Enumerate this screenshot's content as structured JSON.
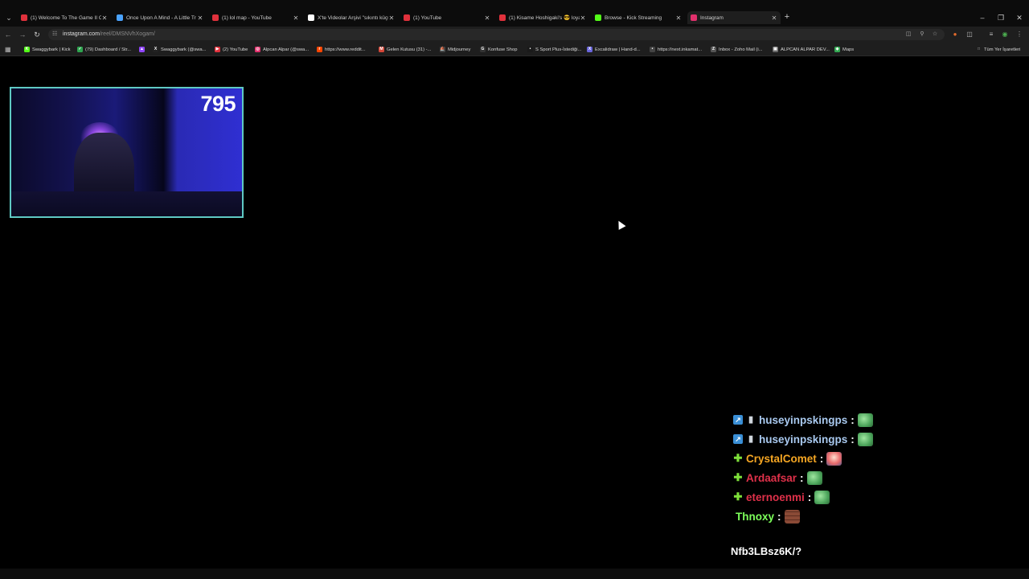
{
  "browser": {
    "tabs": [
      {
        "title": "(1) Welcome To The Game II Of",
        "favicon": "youtube-icon",
        "color": "#e0313c",
        "active": false
      },
      {
        "title": "Once Upon A Mind - A Little Tr",
        "favicon": "bird-icon",
        "color": "#4aa3ff",
        "active": false
      },
      {
        "title": "(1) lol map - YouTube",
        "favicon": "youtube-icon",
        "color": "#e0313c",
        "active": false
      },
      {
        "title": "X'te Videolar Arşivi \"sıkıntı küçü",
        "favicon": "x-icon",
        "color": "#ffffff",
        "active": false
      },
      {
        "title": "(1) YouTube",
        "favicon": "youtube-icon",
        "color": "#e0313c",
        "active": false
      },
      {
        "title": "(1) Kisame Hoshigaki's 😎 loya",
        "favicon": "youtube-icon",
        "color": "#e0313c",
        "active": false
      },
      {
        "title": "Browse - Kick Streaming",
        "favicon": "kick-icon",
        "color": "#53fc18",
        "active": false
      },
      {
        "title": "Instagram",
        "favicon": "instagram-icon",
        "color": "#e1306c",
        "active": true
      }
    ],
    "address": {
      "host": "instagram.com",
      "path": "/reel/DMSNVhXogam/"
    },
    "bookmarks": [
      {
        "label": "Swaggybark | Kick",
        "color": "#53fc18",
        "letter": "K"
      },
      {
        "label": "(79) Dashboard / Str...",
        "color": "#2ea44f",
        "letter": "✓"
      },
      {
        "label": "",
        "color": "#9146ff",
        "letter": "▲"
      },
      {
        "label": "Swaggybark (@swa...",
        "color": "#222222",
        "letter": "X"
      },
      {
        "label": "(2) YouTube",
        "color": "#e0313c",
        "letter": "▶"
      },
      {
        "label": "Alpcan Alpar (@swa...",
        "color": "#e1306c",
        "letter": "◎"
      },
      {
        "label": "https://www.reddit...",
        "color": "#ff4500",
        "letter": "r"
      },
      {
        "label": "Gelen Kutusu (31) -...",
        "color": "#d44638",
        "letter": "M"
      },
      {
        "label": "Midjourney",
        "color": "#444444",
        "letter": "⛵"
      },
      {
        "label": "Konfuse Shop",
        "color": "#333333",
        "letter": "G"
      },
      {
        "label": "S Sport Plus-İstediği...",
        "color": "#1a1a1a",
        "letter": "•"
      },
      {
        "label": "Excalidraw | Hand-d...",
        "color": "#6965db",
        "letter": "X"
      },
      {
        "label": "https://next.inkamat...",
        "color": "#444444",
        "letter": "•"
      },
      {
        "label": "Inbox - Zoho Mail (i...",
        "color": "#555555",
        "letter": "Z"
      },
      {
        "label": "ALPCAN ALPAR DEV...",
        "color": "#666666",
        "letter": "▣"
      },
      {
        "label": "Maps",
        "color": "#34a853",
        "letter": "◈"
      }
    ],
    "all_bookmarks_label": "Tüm Yer İşaretleri"
  },
  "stream": {
    "viewer_count": "795"
  },
  "chat": {
    "messages": [
      {
        "user": "huseyinpskingps",
        "color": "#a9c9ef",
        "badges": [
          "bot-badge",
          "mod-badge"
        ],
        "emote": "pepe"
      },
      {
        "user": "huseyinpskingps",
        "color": "#a9c9ef",
        "badges": [
          "bot-badge",
          "mod-badge"
        ],
        "emote": "pepe"
      },
      {
        "user": "CrystalComet",
        "color": "#f5a623",
        "badges": [
          "plus-badge"
        ],
        "emote": "clown"
      },
      {
        "user": "Ardaafsar",
        "color": "#e0314a",
        "badges": [
          "plus-badge"
        ],
        "emote": "pepe"
      },
      {
        "user": "eternoenmi",
        "color": "#e0314a",
        "badges": [
          "plus-badge"
        ],
        "emote": "pepe"
      },
      {
        "user": "Thnoxy",
        "color": "#7cff5a",
        "badges": [],
        "emote": "brick"
      }
    ],
    "separator": ":",
    "partial_line": "Nfb3LBsz6K/?"
  }
}
